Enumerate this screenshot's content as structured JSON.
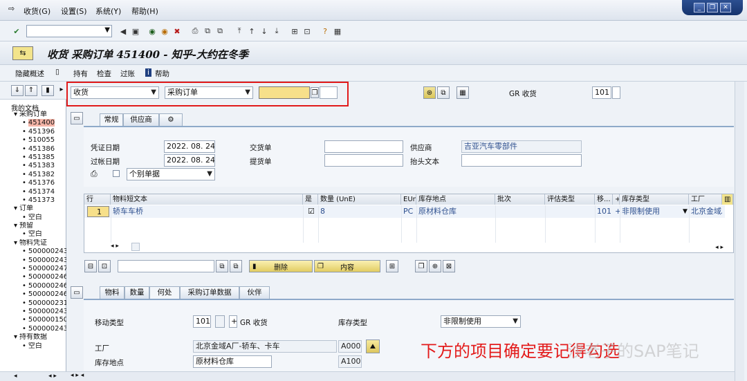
{
  "menubar": {
    "items": [
      "收货(G)",
      "设置(S)",
      "系统(Y)",
      "帮助(H)"
    ]
  },
  "title": {
    "text": "收货 采购订单 451400 - 知乎-大约在冬季"
  },
  "app_toolbar": {
    "hide_overview": "隐藏概述",
    "hold": "持有",
    "check": "检查",
    "post": "过账",
    "help": "帮助"
  },
  "left_panel": {
    "header": "我的文档",
    "tree": [
      {
        "label": "采购订单",
        "level": 0,
        "marker": "▾"
      },
      {
        "label": "451400",
        "level": 1,
        "marker": "•",
        "selected": true
      },
      {
        "label": "451396",
        "level": 1,
        "marker": "•"
      },
      {
        "label": "510055",
        "level": 1,
        "marker": "•"
      },
      {
        "label": "451386",
        "level": 1,
        "marker": "•"
      },
      {
        "label": "451385",
        "level": 1,
        "marker": "•"
      },
      {
        "label": "451383",
        "level": 1,
        "marker": "•"
      },
      {
        "label": "451382",
        "level": 1,
        "marker": "•"
      },
      {
        "label": "451376",
        "level": 1,
        "marker": "•"
      },
      {
        "label": "451374",
        "level": 1,
        "marker": "•"
      },
      {
        "label": "451373",
        "level": 1,
        "marker": "•"
      },
      {
        "label": "订单",
        "level": 0,
        "marker": "▾"
      },
      {
        "label": "空白",
        "level": 1,
        "marker": "•"
      },
      {
        "label": "预留",
        "level": 0,
        "marker": "▾"
      },
      {
        "label": "空白",
        "level": 1,
        "marker": "•"
      },
      {
        "label": "物料凭证",
        "level": 0,
        "marker": "▾"
      },
      {
        "label": "500000243!",
        "level": 1,
        "marker": "•"
      },
      {
        "label": "500000243:",
        "level": 1,
        "marker": "•"
      },
      {
        "label": "500000247(",
        "level": 1,
        "marker": "•"
      },
      {
        "label": "500000246!",
        "level": 1,
        "marker": "•"
      },
      {
        "label": "500000246:",
        "level": 1,
        "marker": "•"
      },
      {
        "label": "500000246:",
        "level": 1,
        "marker": "•"
      },
      {
        "label": "500000231!",
        "level": 1,
        "marker": "•"
      },
      {
        "label": "500000243!",
        "level": 1,
        "marker": "•"
      },
      {
        "label": "500000150(",
        "level": 1,
        "marker": "•"
      },
      {
        "label": "500000243!",
        "level": 1,
        "marker": "•"
      },
      {
        "label": "持有数据",
        "level": 0,
        "marker": "▾"
      },
      {
        "label": "空白",
        "level": 1,
        "marker": "•"
      }
    ]
  },
  "header_fields": {
    "transaction": "收货",
    "reference": "采购订单",
    "po_number": "",
    "gr_label": "GR 收货",
    "movement": "101"
  },
  "tabs_top": [
    "常规",
    "供应商"
  ],
  "general": {
    "doc_date_label": "凭证日期",
    "doc_date": "2022. 08. 24",
    "post_date_label": "过帐日期",
    "post_date": "2022. 08. 24",
    "delivery_note_label": "交货单",
    "bill_of_lading_label": "提货单",
    "vendor_label": "供应商",
    "vendor": "吉亚汽车零部件",
    "header_text_label": "抬头文本",
    "slip_option": "个别单据"
  },
  "grid": {
    "headers": [
      "行",
      "物料短文本",
      "是",
      "数量 (UnE)",
      "EUn",
      "库存地点",
      "批次",
      "评估类型",
      "移...",
      "+",
      "库存类型",
      "工厂"
    ],
    "rows": [
      {
        "line": "1",
        "material": "轿车车桥",
        "ok": true,
        "qty": "8",
        "unit": "PC",
        "sloc": "原材料仓库",
        "batch": "",
        "valtype": "",
        "mvt": "101",
        "plus": "+",
        "stock_type": "非限制使用",
        "plant": "北京金域A"
      }
    ]
  },
  "grid_toolbar": {
    "delete": "删除",
    "content": "内容"
  },
  "tabs_bottom": [
    "物料",
    "数量",
    "何处",
    "采购订单数据",
    "伙伴"
  ],
  "where": {
    "mvt_label": "移动类型",
    "mvt": "101",
    "plus": "+",
    "gr_label": "GR 收货",
    "stock_type_label": "库存类型",
    "stock_type": "非限制使用",
    "plant_label": "工厂",
    "plant": "北京金域A厂-轿车、卡车",
    "plant_code": "A000",
    "sloc_label": "库存地点",
    "sloc": "原材料仓库",
    "sloc_code": "A100"
  },
  "annotation": "下方的项目确定要记得勾选",
  "watermark": "沙老子的SAP笔记"
}
